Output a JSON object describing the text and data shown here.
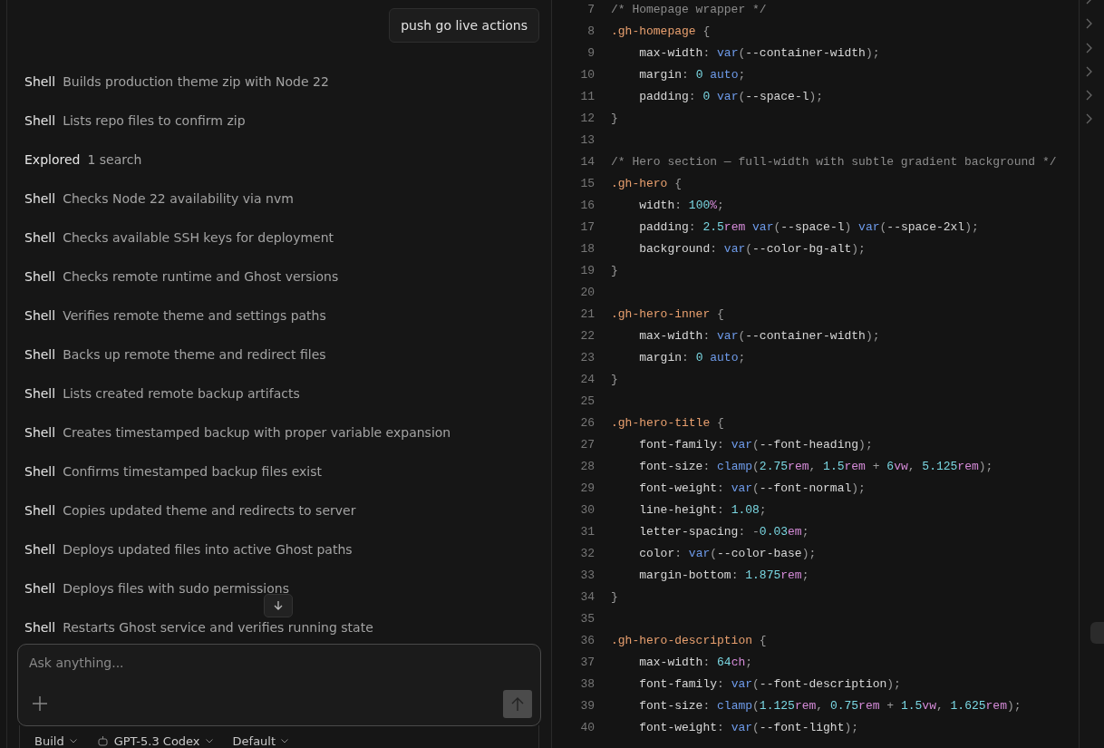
{
  "chat": {
    "user_message": "push go live actions",
    "steps": [
      {
        "label": "Shell",
        "text": "Builds production theme zip with Node 22"
      },
      {
        "label": "Shell",
        "text": "Lists repo files to confirm zip"
      },
      {
        "label": "Explored",
        "text": "1 search"
      },
      {
        "label": "Shell",
        "text": "Checks Node 22 availability via nvm"
      },
      {
        "label": "Shell",
        "text": "Checks available SSH keys for deployment"
      },
      {
        "label": "Shell",
        "text": "Checks remote runtime and Ghost versions"
      },
      {
        "label": "Shell",
        "text": "Verifies remote theme and settings paths"
      },
      {
        "label": "Shell",
        "text": "Backs up remote theme and redirect files"
      },
      {
        "label": "Shell",
        "text": "Lists created remote backup artifacts"
      },
      {
        "label": "Shell",
        "text": "Creates timestamped backup with proper variable expansion"
      },
      {
        "label": "Shell",
        "text": "Confirms timestamped backup files exist"
      },
      {
        "label": "Shell",
        "text": "Copies updated theme and redirects to server"
      },
      {
        "label": "Shell",
        "text": "Deploys updated files into active Ghost paths"
      },
      {
        "label": "Shell",
        "text": "Deploys files with sudo permissions"
      },
      {
        "label": "Shell",
        "text": "Restarts Ghost service and verifies running state"
      }
    ],
    "composer": {
      "placeholder": "Ask anything..."
    },
    "toolbar": [
      {
        "kind": "agent",
        "label": "Build"
      },
      {
        "kind": "model",
        "label": "GPT-5.3 Codex"
      },
      {
        "kind": "variant",
        "label": "Default"
      }
    ]
  },
  "editor": {
    "lines": [
      {
        "number": "7",
        "tokens": [
          {
            "kind": "comment",
            "text": "/* Homepage wrapper */"
          }
        ]
      },
      {
        "number": "8",
        "tokens": [
          {
            "kind": "selector",
            "text": ".gh-homepage"
          },
          {
            "kind": "punct",
            "text": " {"
          }
        ]
      },
      {
        "number": "9",
        "tokens": [
          {
            "kind": "prop",
            "text": "    max-width"
          },
          {
            "kind": "punct",
            "text": ": "
          },
          {
            "kind": "func",
            "text": "var"
          },
          {
            "kind": "punct",
            "text": "("
          },
          {
            "kind": "prop",
            "text": "--container-width"
          },
          {
            "kind": "punct",
            "text": ");"
          }
        ]
      },
      {
        "number": "10",
        "tokens": [
          {
            "kind": "prop",
            "text": "    margin"
          },
          {
            "kind": "punct",
            "text": ": "
          },
          {
            "kind": "num",
            "text": "0"
          },
          {
            "kind": "func",
            "text": " auto"
          },
          {
            "kind": "punct",
            "text": ";"
          }
        ]
      },
      {
        "number": "11",
        "tokens": [
          {
            "kind": "prop",
            "text": "    padding"
          },
          {
            "kind": "punct",
            "text": ": "
          },
          {
            "kind": "num",
            "text": "0"
          },
          {
            "kind": "func",
            "text": " var"
          },
          {
            "kind": "punct",
            "text": "("
          },
          {
            "kind": "prop",
            "text": "--space-l"
          },
          {
            "kind": "punct",
            "text": ");"
          }
        ]
      },
      {
        "number": "12",
        "tokens": [
          {
            "kind": "punct",
            "text": "}"
          }
        ]
      },
      {
        "number": "13"
      },
      {
        "number": "14",
        "tokens": [
          {
            "kind": "comment",
            "text": "/* Hero section — full-width with subtle gradient background */"
          }
        ]
      },
      {
        "number": "15",
        "tokens": [
          {
            "kind": "selector",
            "text": ".gh-hero"
          },
          {
            "kind": "punct",
            "text": " {"
          }
        ]
      },
      {
        "number": "16",
        "tokens": [
          {
            "kind": "prop",
            "text": "    width"
          },
          {
            "kind": "punct",
            "text": ": "
          },
          {
            "kind": "num",
            "text": "100"
          },
          {
            "kind": "unit",
            "text": "%"
          },
          {
            "kind": "punct",
            "text": ";"
          }
        ]
      },
      {
        "number": "17",
        "tokens": [
          {
            "kind": "prop",
            "text": "    padding"
          },
          {
            "kind": "punct",
            "text": ": "
          },
          {
            "kind": "num",
            "text": "2.5"
          },
          {
            "kind": "unit",
            "text": "rem"
          },
          {
            "kind": "func",
            "text": " var"
          },
          {
            "kind": "punct",
            "text": "("
          },
          {
            "kind": "prop",
            "text": "--space-l"
          },
          {
            "kind": "punct",
            "text": ")"
          },
          {
            "kind": "func",
            "text": " var"
          },
          {
            "kind": "punct",
            "text": "("
          },
          {
            "kind": "prop",
            "text": "--space-2xl"
          },
          {
            "kind": "punct",
            "text": ");"
          }
        ]
      },
      {
        "number": "18",
        "tokens": [
          {
            "kind": "prop",
            "text": "    background"
          },
          {
            "kind": "punct",
            "text": ": "
          },
          {
            "kind": "func",
            "text": "var"
          },
          {
            "kind": "punct",
            "text": "("
          },
          {
            "kind": "prop",
            "text": "--color-bg-alt"
          },
          {
            "kind": "punct",
            "text": ");"
          }
        ]
      },
      {
        "number": "19",
        "tokens": [
          {
            "kind": "punct",
            "text": "}"
          }
        ]
      },
      {
        "number": "20"
      },
      {
        "number": "21",
        "tokens": [
          {
            "kind": "selector",
            "text": ".gh-hero-inner"
          },
          {
            "kind": "punct",
            "text": " {"
          }
        ]
      },
      {
        "number": "22",
        "tokens": [
          {
            "kind": "prop",
            "text": "    max-width"
          },
          {
            "kind": "punct",
            "text": ": "
          },
          {
            "kind": "func",
            "text": "var"
          },
          {
            "kind": "punct",
            "text": "("
          },
          {
            "kind": "prop",
            "text": "--container-width"
          },
          {
            "kind": "punct",
            "text": ");"
          }
        ]
      },
      {
        "number": "23",
        "tokens": [
          {
            "kind": "prop",
            "text": "    margin"
          },
          {
            "kind": "punct",
            "text": ": "
          },
          {
            "kind": "num",
            "text": "0"
          },
          {
            "kind": "func",
            "text": " auto"
          },
          {
            "kind": "punct",
            "text": ";"
          }
        ]
      },
      {
        "number": "24",
        "tokens": [
          {
            "kind": "punct",
            "text": "}"
          }
        ]
      },
      {
        "number": "25"
      },
      {
        "number": "26",
        "tokens": [
          {
            "kind": "selector",
            "text": ".gh-hero-title"
          },
          {
            "kind": "punct",
            "text": " {"
          }
        ]
      },
      {
        "number": "27",
        "tokens": [
          {
            "kind": "prop",
            "text": "    font-family"
          },
          {
            "kind": "punct",
            "text": ": "
          },
          {
            "kind": "func",
            "text": "var"
          },
          {
            "kind": "punct",
            "text": "("
          },
          {
            "kind": "prop",
            "text": "--font-heading"
          },
          {
            "kind": "punct",
            "text": ");"
          }
        ]
      },
      {
        "number": "28",
        "tokens": [
          {
            "kind": "prop",
            "text": "    font-size"
          },
          {
            "kind": "punct",
            "text": ": "
          },
          {
            "kind": "func",
            "text": "clamp"
          },
          {
            "kind": "punct",
            "text": "("
          },
          {
            "kind": "num",
            "text": "2.75"
          },
          {
            "kind": "unit",
            "text": "rem"
          },
          {
            "kind": "punct",
            "text": ", "
          },
          {
            "kind": "num",
            "text": "1.5"
          },
          {
            "kind": "unit",
            "text": "rem"
          },
          {
            "kind": "punct",
            "text": " + "
          },
          {
            "kind": "num",
            "text": "6"
          },
          {
            "kind": "unit",
            "text": "vw"
          },
          {
            "kind": "punct",
            "text": ", "
          },
          {
            "kind": "num",
            "text": "5.125"
          },
          {
            "kind": "unit",
            "text": "rem"
          },
          {
            "kind": "punct",
            "text": ");"
          }
        ]
      },
      {
        "number": "29",
        "tokens": [
          {
            "kind": "prop",
            "text": "    font-weight"
          },
          {
            "kind": "punct",
            "text": ": "
          },
          {
            "kind": "func",
            "text": "var"
          },
          {
            "kind": "punct",
            "text": "("
          },
          {
            "kind": "prop",
            "text": "--font-normal"
          },
          {
            "kind": "punct",
            "text": ");"
          }
        ]
      },
      {
        "number": "30",
        "tokens": [
          {
            "kind": "prop",
            "text": "    line-height"
          },
          {
            "kind": "punct",
            "text": ": "
          },
          {
            "kind": "num",
            "text": "1.08"
          },
          {
            "kind": "punct",
            "text": ";"
          }
        ]
      },
      {
        "number": "31",
        "tokens": [
          {
            "kind": "prop",
            "text": "    letter-spacing"
          },
          {
            "kind": "punct",
            "text": ": -"
          },
          {
            "kind": "num",
            "text": "0.03"
          },
          {
            "kind": "unit",
            "text": "em"
          },
          {
            "kind": "punct",
            "text": ";"
          }
        ]
      },
      {
        "number": "32",
        "tokens": [
          {
            "kind": "prop",
            "text": "    color"
          },
          {
            "kind": "punct",
            "text": ": "
          },
          {
            "kind": "func",
            "text": "var"
          },
          {
            "kind": "punct",
            "text": "("
          },
          {
            "kind": "prop",
            "text": "--color-base"
          },
          {
            "kind": "punct",
            "text": ");"
          }
        ]
      },
      {
        "number": "33",
        "tokens": [
          {
            "kind": "prop",
            "text": "    margin-bottom"
          },
          {
            "kind": "punct",
            "text": ": "
          },
          {
            "kind": "num",
            "text": "1.875"
          },
          {
            "kind": "unit",
            "text": "rem"
          },
          {
            "kind": "punct",
            "text": ";"
          }
        ]
      },
      {
        "number": "34",
        "tokens": [
          {
            "kind": "punct",
            "text": "}"
          }
        ]
      },
      {
        "number": "35"
      },
      {
        "number": "36",
        "tokens": [
          {
            "kind": "selector",
            "text": ".gh-hero-description"
          },
          {
            "kind": "punct",
            "text": " {"
          }
        ]
      },
      {
        "number": "37",
        "tokens": [
          {
            "kind": "prop",
            "text": "    max-width"
          },
          {
            "kind": "punct",
            "text": ": "
          },
          {
            "kind": "num",
            "text": "64"
          },
          {
            "kind": "unit",
            "text": "ch"
          },
          {
            "kind": "punct",
            "text": ";"
          }
        ]
      },
      {
        "number": "38",
        "tokens": [
          {
            "kind": "prop",
            "text": "    font-family"
          },
          {
            "kind": "punct",
            "text": ": "
          },
          {
            "kind": "func",
            "text": "var"
          },
          {
            "kind": "punct",
            "text": "("
          },
          {
            "kind": "prop",
            "text": "--font-description"
          },
          {
            "kind": "punct",
            "text": ");"
          }
        ]
      },
      {
        "number": "39",
        "tokens": [
          {
            "kind": "prop",
            "text": "    font-size"
          },
          {
            "kind": "punct",
            "text": ": "
          },
          {
            "kind": "func",
            "text": "clamp"
          },
          {
            "kind": "punct",
            "text": "("
          },
          {
            "kind": "num",
            "text": "1.125"
          },
          {
            "kind": "unit",
            "text": "rem"
          },
          {
            "kind": "punct",
            "text": ", "
          },
          {
            "kind": "num",
            "text": "0.75"
          },
          {
            "kind": "unit",
            "text": "rem"
          },
          {
            "kind": "punct",
            "text": " + "
          },
          {
            "kind": "num",
            "text": "1.5"
          },
          {
            "kind": "unit",
            "text": "vw"
          },
          {
            "kind": "punct",
            "text": ", "
          },
          {
            "kind": "num",
            "text": "1.625"
          },
          {
            "kind": "unit",
            "text": "rem"
          },
          {
            "kind": "punct",
            "text": ");"
          }
        ]
      },
      {
        "number": "40",
        "tokens": [
          {
            "kind": "prop",
            "text": "    font-weight"
          },
          {
            "kind": "punct",
            "text": ": "
          },
          {
            "kind": "func",
            "text": "var"
          },
          {
            "kind": "punct",
            "text": "("
          },
          {
            "kind": "prop",
            "text": "--font-light"
          },
          {
            "kind": "punct",
            "text": ");"
          }
        ]
      }
    ]
  }
}
